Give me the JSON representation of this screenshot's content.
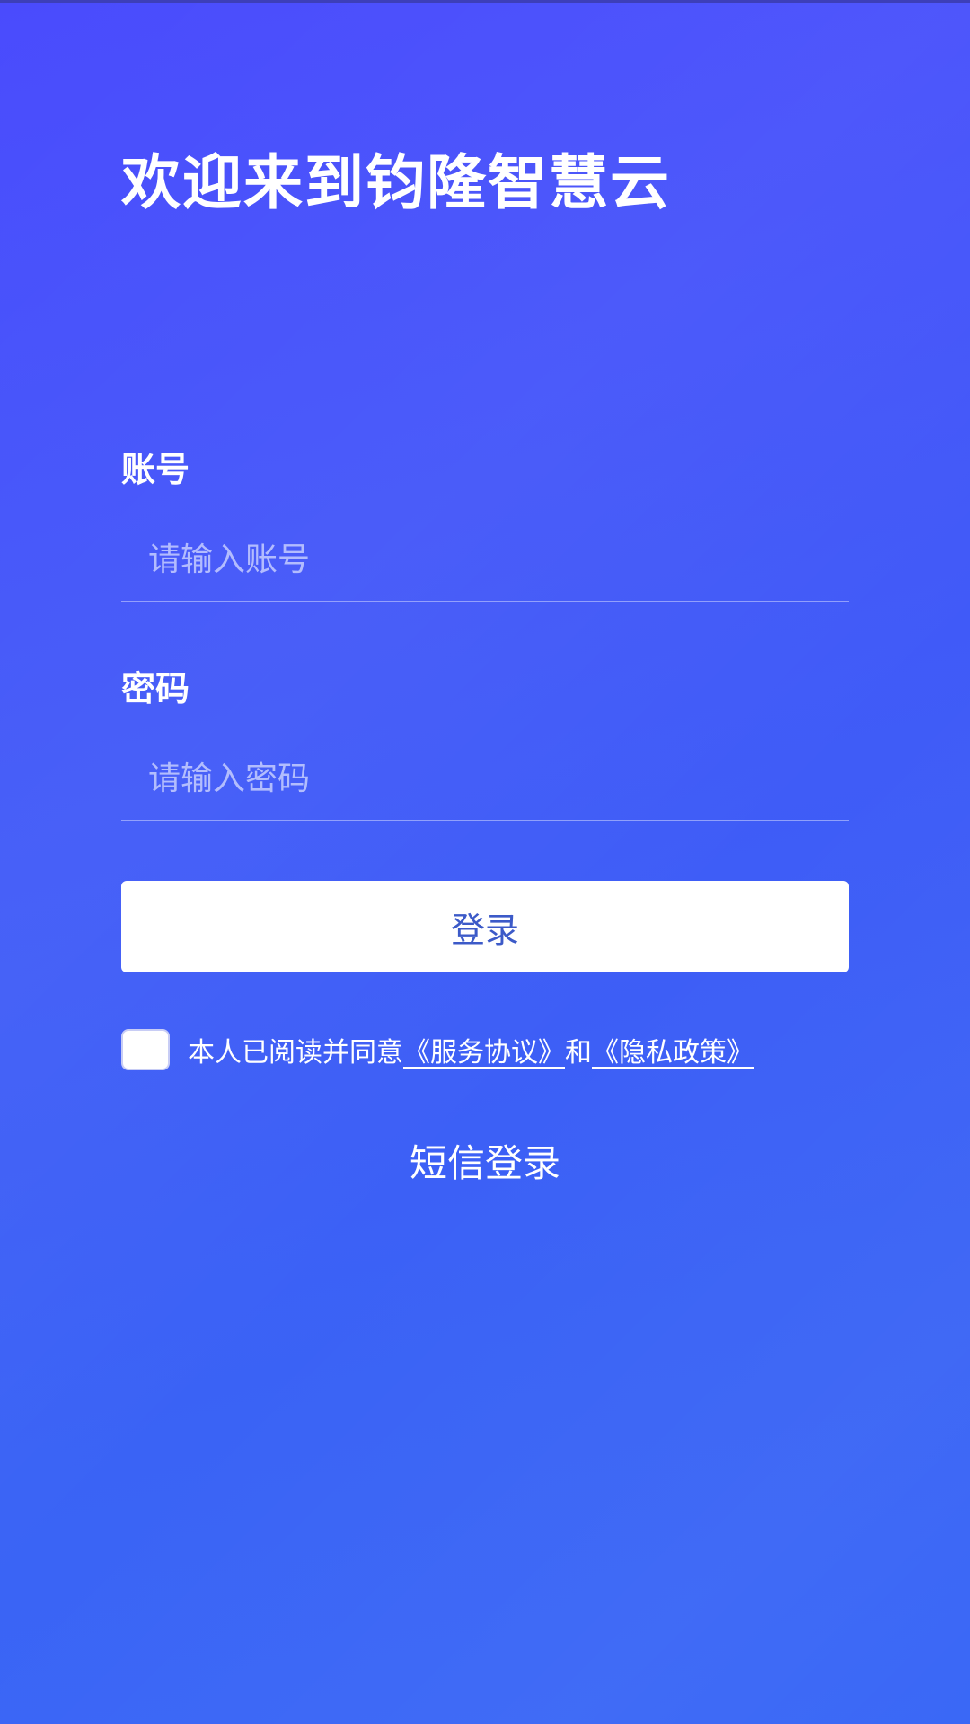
{
  "header": {
    "title": "欢迎来到钧隆智慧云"
  },
  "form": {
    "account_label": "账号",
    "account_placeholder": "请输入账号",
    "password_label": "密码",
    "password_placeholder": "请输入密码",
    "login_label": "登录"
  },
  "agreement": {
    "prefix": "本人已阅读并同意",
    "service_link": "《服务协议》",
    "and": "和",
    "privacy_link": "《隐私政策》"
  },
  "alt_login": {
    "sms_label": "短信登录"
  },
  "colors": {
    "bg_top": "#4a4bfd",
    "bg_bottom": "#3a68f6",
    "button_text": "#3c5ac8"
  }
}
